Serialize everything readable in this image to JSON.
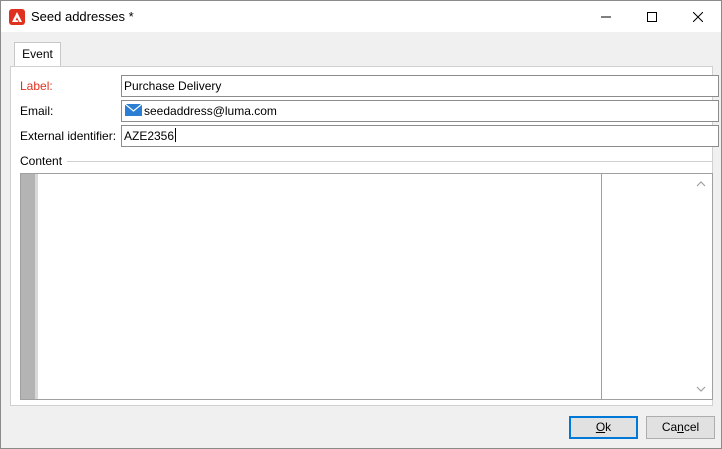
{
  "window": {
    "title": "Seed addresses *",
    "app_icon": "adobe-campaign-icon",
    "controls": {
      "minimize": "minimize-icon",
      "maximize": "maximize-icon",
      "close": "close-icon"
    }
  },
  "tabs": [
    {
      "label": "Event",
      "active": true
    }
  ],
  "form": {
    "label_field": {
      "label": "Label:",
      "value": "Purchase Delivery",
      "required": true
    },
    "email_field": {
      "label": "Email:",
      "value": "seedaddress@luma.com",
      "icon": "email-icon"
    },
    "external_id_field": {
      "label": "External identifier:",
      "value": "AZE2356"
    }
  },
  "content_section": {
    "legend": "Content"
  },
  "buttons": {
    "ok": {
      "label_underlined": "O",
      "label_rest": "k"
    },
    "cancel": {
      "label_prefix": "Ca",
      "label_underlined": "n",
      "label_rest": "cel"
    }
  },
  "colors": {
    "required_label": "#e0301e",
    "focus_border": "#0078d7",
    "app_icon_bg": "#e0301e"
  }
}
